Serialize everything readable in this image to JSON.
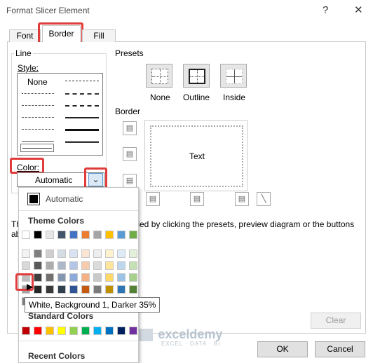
{
  "window": {
    "title": "Format Slicer Element",
    "help_label": "?",
    "close_label": "✕"
  },
  "tabs": [
    {
      "label": "Font"
    },
    {
      "label": "Border"
    },
    {
      "label": "Fill"
    }
  ],
  "line_group": {
    "label": "Line",
    "style_label": "Style:",
    "none_option": "None",
    "color_label": "Color:",
    "color_value": "Automatic"
  },
  "presets": {
    "label": "Presets",
    "items": [
      {
        "label": "None"
      },
      {
        "label": "Outline"
      },
      {
        "label": "Inside"
      }
    ]
  },
  "border": {
    "label": "Border",
    "preview_text": "Text"
  },
  "hint_text": "The selected border style can be applied by clicking the presets, preview diagram or the buttons above.",
  "hint_visible_start": "Th",
  "hint_visible_line2": "ab",
  "hint_visible_end": "plied by clicking the presets, preview diagram or the buttons",
  "buttons": {
    "clear": "Clear",
    "ok": "OK",
    "cancel": "Cancel"
  },
  "color_menu": {
    "automatic_label": "Automatic",
    "theme_header": "Theme Colors",
    "standard_header": "Standard Colors",
    "recent_header": "Recent Colors",
    "tooltip": "White, Background 1, Darker 35%",
    "theme_top": [
      "#ffffff",
      "#000000",
      "#e7e6e6",
      "#44546a",
      "#4472c4",
      "#ed7d31",
      "#a5a5a5",
      "#ffc000",
      "#5b9bd5",
      "#70ad47"
    ],
    "theme_shades": [
      [
        "#f2f2f2",
        "#7f7f7f",
        "#d0cece",
        "#d6dce4",
        "#d9e2f3",
        "#fbe5d5",
        "#ededed",
        "#fff2cc",
        "#deebf6",
        "#e2efd9"
      ],
      [
        "#d8d8d8",
        "#595959",
        "#aeabab",
        "#adb9ca",
        "#b4c6e7",
        "#f7cbac",
        "#dbdbdb",
        "#fee599",
        "#bdd7ee",
        "#c5e0b3"
      ],
      [
        "#bfbfbf",
        "#3f3f3f",
        "#757070",
        "#8496b0",
        "#8eaadb",
        "#f4b183",
        "#c9c9c9",
        "#ffd966",
        "#9cc3e5",
        "#a8d08d"
      ],
      [
        "#a5a5a5",
        "#262626",
        "#3a3838",
        "#323f4f",
        "#2f5496",
        "#c55a11",
        "#7b7b7b",
        "#bf9000",
        "#2e75b5",
        "#538135"
      ],
      [
        "#7f7f7f",
        "#0c0c0c",
        "#171616",
        "#222a35",
        "#1f3864",
        "#833c0b",
        "#525252",
        "#7f6000",
        "#1e4e79",
        "#375623"
      ]
    ],
    "standard": [
      "#c00000",
      "#ff0000",
      "#ffc000",
      "#ffff00",
      "#92d050",
      "#00b050",
      "#00b0f0",
      "#0070c0",
      "#002060",
      "#7030a0"
    ],
    "accent_highlight": "#e03c3c"
  },
  "watermark": {
    "name": "exceldemy",
    "tagline": "EXCEL · DATA · BI"
  }
}
